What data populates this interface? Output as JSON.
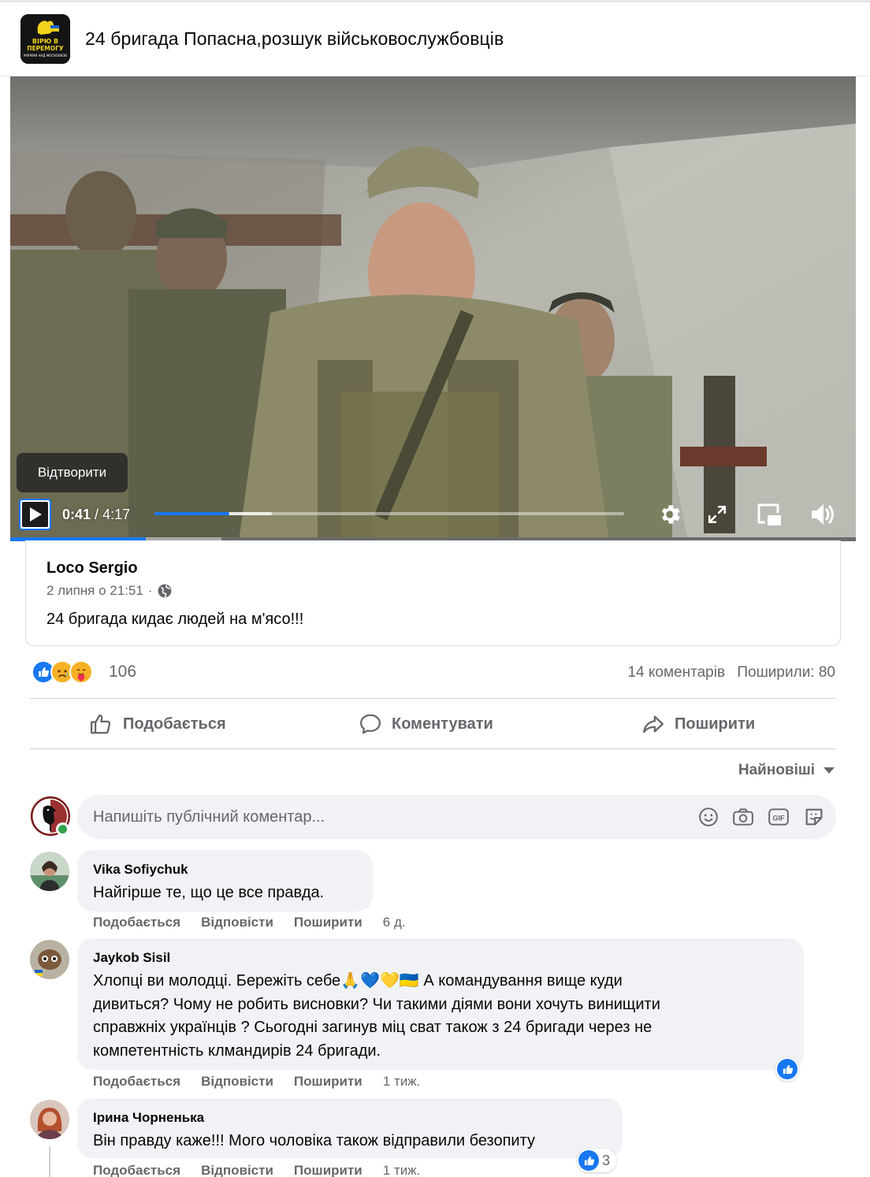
{
  "header": {
    "page_name": "24 бригада Попасна,розшук військовослужбовців",
    "avatar_text": [
      "ВІРЮ В",
      "ПЕРЕМОГУ",
      "УКРАЇНИ НАД МОСКОВІЄЮ"
    ]
  },
  "video": {
    "tooltip": "Відтворити",
    "current_time": "0:41",
    "separator": "/",
    "duration": "4:17",
    "progress_fraction": 0.16,
    "buffered_fraction": 0.25,
    "controls": [
      "play-icon",
      "gear-icon",
      "fullscreen-icon",
      "miniplayer-icon",
      "volume-icon"
    ]
  },
  "shared_post": {
    "author": "Loco Sergio",
    "date": "2 липня о 21:51",
    "separator": "·",
    "text": "24 бригада кидає людей на м'ясо!!!"
  },
  "summary": {
    "reaction_icons": [
      "like",
      "sad",
      "care"
    ],
    "reaction_count": "106",
    "comments": "14 коментарів",
    "shares": "Поширили: 80"
  },
  "actions": {
    "like": "Подобається",
    "comment": "Коментувати",
    "share": "Поширити"
  },
  "sort": {
    "label": "Найновіші"
  },
  "composer": {
    "placeholder": "Напишіть публічний коментар...",
    "icons": [
      "emoji-icon",
      "camera-icon",
      "gif-icon",
      "sticker-icon"
    ]
  },
  "comments": [
    {
      "name": "Vika Sofiychuk",
      "lines": [
        "Найгірше те, що це все правда."
      ],
      "actions": [
        "Подобається",
        "Відповісти",
        "Поширити"
      ],
      "ago": "6 д."
    },
    {
      "name": "Jaykob Sisil",
      "lines": [
        "Хлопці ви молодці. Бережіть себе🙏💙💛🇺🇦 А командування вище куди",
        "дивиться? Чому не робить висновки? Чи такими діями вони хочуть винищити",
        "справжніх українців ? Сьогодні загинув міц сват також з 24 бригади через не",
        "компетентність клмандирів 24 бригади."
      ],
      "actions": [
        "Подобається",
        "Відповісти",
        "Поширити"
      ],
      "ago": "1 тиж.",
      "likes": ""
    },
    {
      "name": "Ірина Чорненька",
      "lines": [
        "Він правду каже!!! Мого чоловіка також відправили безопиту"
      ],
      "actions": [
        "Подобається",
        "Відповісти",
        "Поширити"
      ],
      "ago": "1 тиж.",
      "likes": "3"
    }
  ],
  "colors": {
    "accent": "#1877f2",
    "secondary_text": "#65676b",
    "bubble": "#f0f2f5",
    "online": "#31a24c"
  }
}
